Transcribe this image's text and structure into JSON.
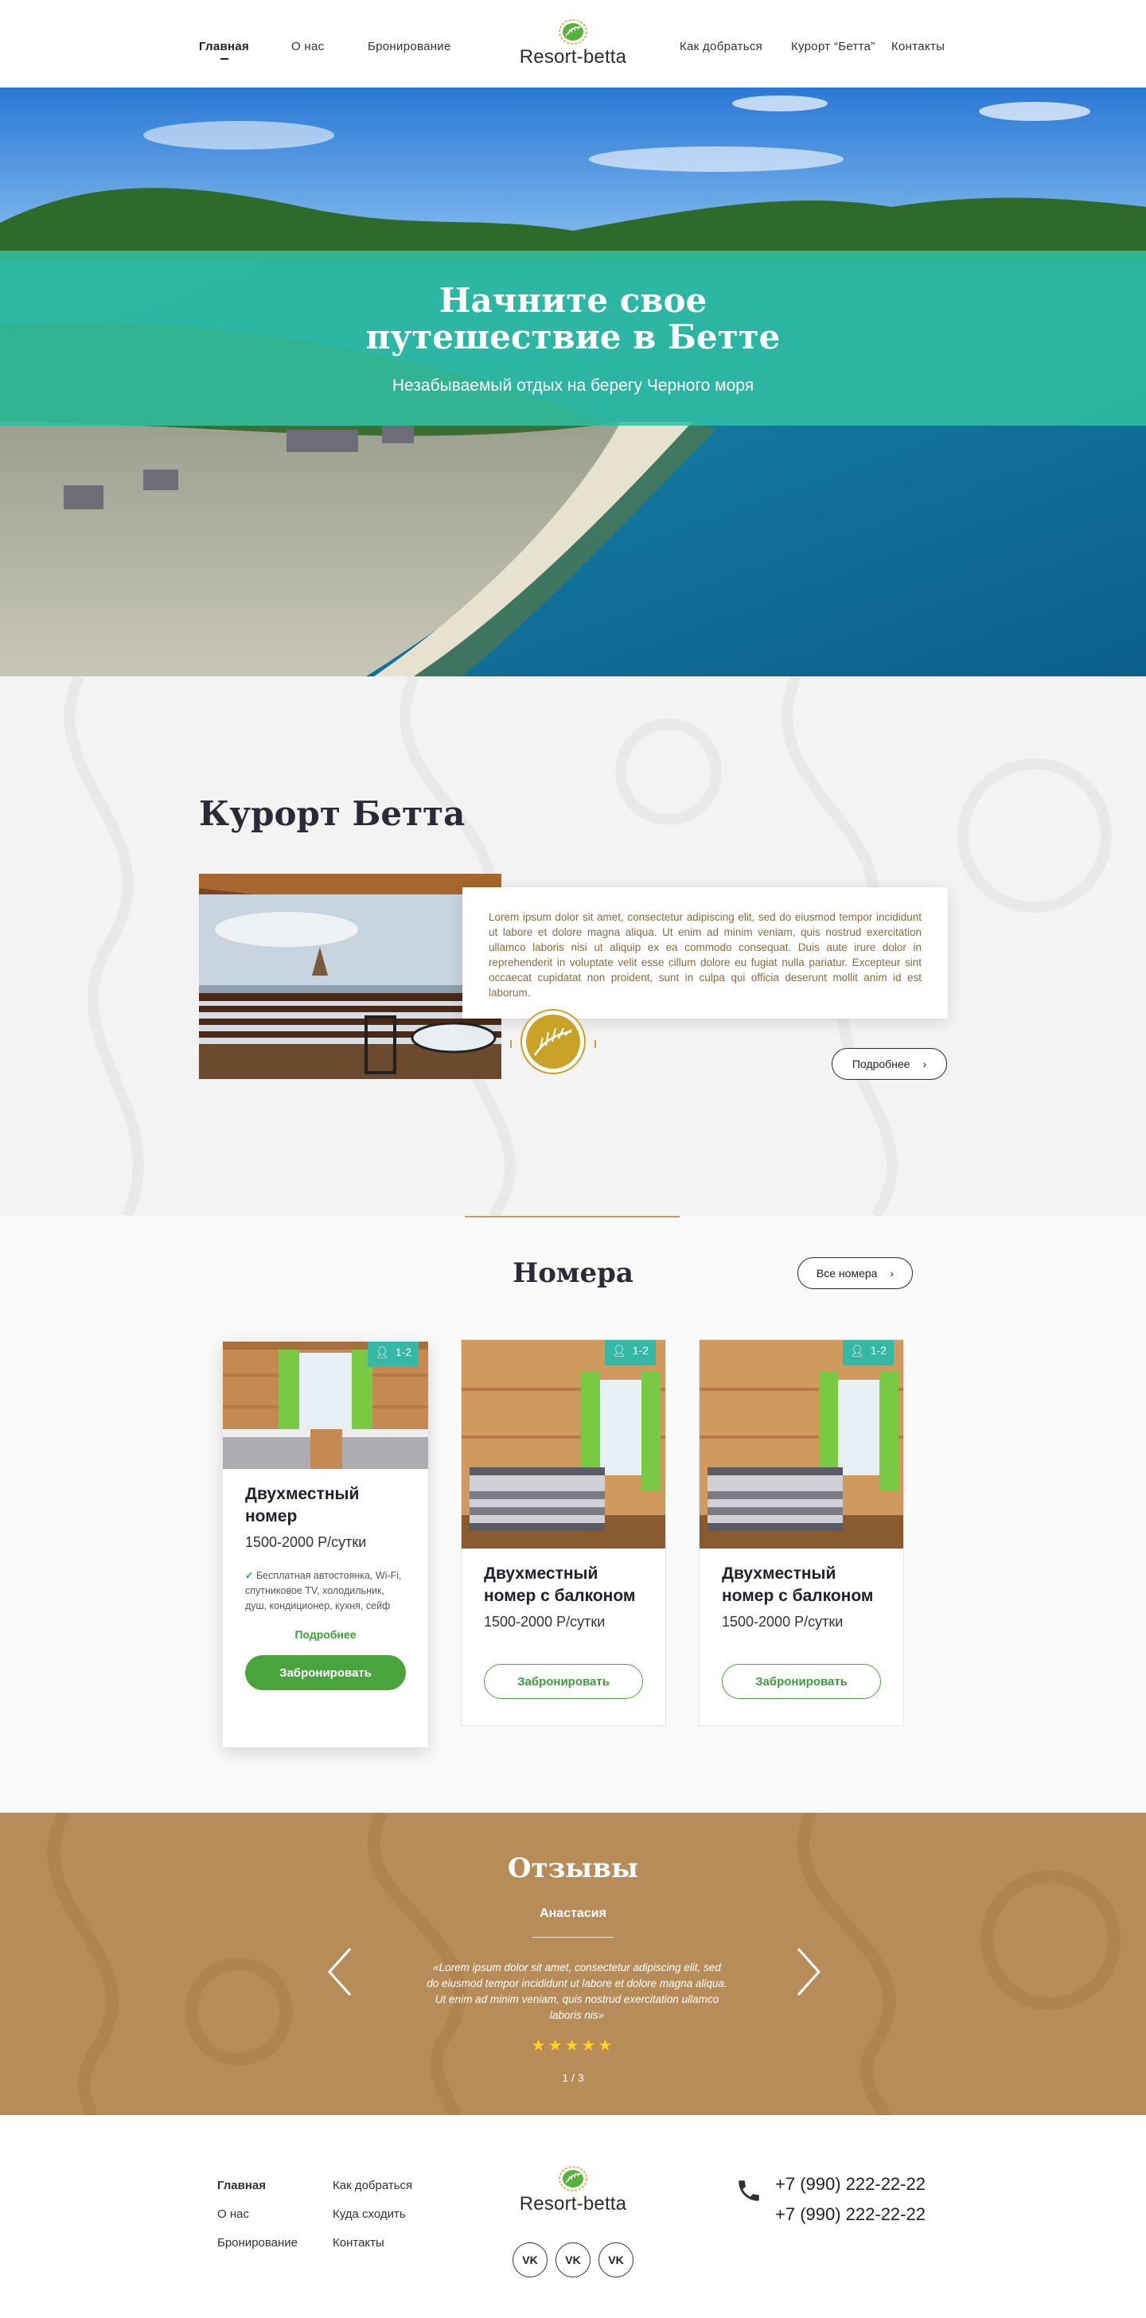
{
  "header": {
    "nav_left": [
      "Главная",
      "О нас",
      "Бронирование"
    ],
    "nav_right": [
      "Как добраться",
      "Курорт “Бетта”",
      "Контакты"
    ],
    "logo_text": "Resort-betta"
  },
  "hero": {
    "title_line1": "Начните свое",
    "title_line2": "путешествие в Бетте",
    "subtitle": "Незабываемый отдых на берегу Черного моря"
  },
  "about": {
    "title": "Курорт Бетта",
    "text": "Lorem ipsum dolor sit amet, consectetur adipiscing elit, sed do eiusmod tempor incididunt ut labore et dolore magna aliqua. Ut enim ad minim veniam, quis nostrud exercitation ullamco laboris nisi ut aliquip ex ea commodo consequat. Duis aute irure dolor in reprehenderit in voluptate velit esse cillum dolore eu fugiat nulla pariatur. Excepteur sint occaecat cupidatat non proident, sunt in culpa qui officia deserunt mollit anim id est laborum.",
    "more_label": "Подробнее"
  },
  "rooms": {
    "title": "Номера",
    "all_label": "Все номера",
    "cards": [
      {
        "badge": "1-2",
        "name": "Двухместный номер",
        "price": "1500-2000 Р/сутки",
        "features": "Бесплатная автостоянка, Wi-Fi, спутниковое TV, холодильник, душ, кондиционер, кухня, сейф",
        "more": "Подробнее",
        "book": "Забронировать"
      },
      {
        "badge": "1-2",
        "name": "Двухместный номер с балконом",
        "price": "1500-2000 Р/сутки",
        "book": "Забронировать"
      },
      {
        "badge": "1-2",
        "name": "Двухместный номер с балконом",
        "price": "1500-2000 Р/сутки",
        "book": "Забронировать"
      }
    ]
  },
  "reviews": {
    "title": "Отзывы",
    "author": "Анастасия",
    "text": "«Lorem ipsum dolor sit amet, consectetur adipiscing elit, sed do eiusmod tempor incididunt ut labore et dolore magna aliqua. Ut enim ad minim veniam, quis nostrud exercitation ullamco laboris nis»",
    "stars": "★★★★★",
    "rating": 5,
    "pager": "1 / 3"
  },
  "footer": {
    "col1": [
      "Главная",
      "О нас",
      "Бронирование"
    ],
    "col2": [
      "Как добраться",
      "Куда сходить",
      "Контакты"
    ],
    "logo_text": "Resort-betta",
    "phones": [
      "+7 (990) 222-22-22",
      "+7 (990) 222-22-22"
    ],
    "social": [
      "VK",
      "VK",
      "VK"
    ]
  },
  "colors": {
    "accent_teal": "#30c0a2",
    "green": "#4aa43d",
    "brown": "#b88c58",
    "gold": "#c9a227"
  }
}
